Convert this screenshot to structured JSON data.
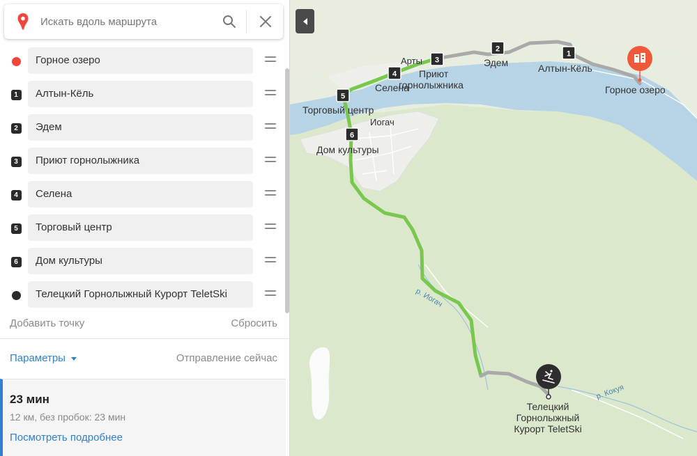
{
  "search": {
    "placeholder": "Искать вдоль маршрута"
  },
  "waypoints": [
    {
      "label": "Горное озеро",
      "marker": "red-dot"
    },
    {
      "label": "Алтын-Кёль",
      "marker": "1"
    },
    {
      "label": "Эдем",
      "marker": "2"
    },
    {
      "label": "Приют горнолыжника",
      "marker": "3"
    },
    {
      "label": "Селена",
      "marker": "4"
    },
    {
      "label": "Торговый центр",
      "marker": "5"
    },
    {
      "label": "Дом культуры",
      "marker": "6"
    },
    {
      "label": "Телецкий Горнолыжный Курорт TeletSki",
      "marker": "black-dot"
    }
  ],
  "actions": {
    "add_point": "Добавить точку",
    "reset": "Сбросить"
  },
  "params": {
    "label": "Параметры",
    "departure": "Отправление сейчас"
  },
  "route": {
    "time": "23 мин",
    "details": "12 км, без пробок: 23 мин",
    "more": "Посмотреть подробнее"
  },
  "map": {
    "labels": {
      "artybash": "Арты",
      "priut_1": "Приют",
      "priut_2": "горнолыжника",
      "edem": "Эдем",
      "altyn": "Алтын-Кёль",
      "gornoe": "Горное озеро",
      "selena": "Селена",
      "trade": "Торговый центр",
      "iogach": "Иогач",
      "dom": "Дом культуры",
      "river_iogach": "р. Иогач",
      "river_kokuya": "р. Кокуя",
      "resort_1": "Телецкий",
      "resort_2": "Горнолыжный",
      "resort_3": "Курорт TeletSki"
    },
    "markers": {
      "m1": "1",
      "m2": "2",
      "m3": "3",
      "m4": "4",
      "m5": "5",
      "m6": "6"
    }
  },
  "colors": {
    "accent": "#2f80d1",
    "route_active": "#7ac74f",
    "route_inactive": "#a9a9a9",
    "start_marker": "#f2453d",
    "hotel_marker": "#f05a3a",
    "water": "#b4d3e6",
    "forest": "#dce9cf",
    "land": "#ecede6"
  },
  "icons": {
    "logo": "map-pin-icon",
    "search": "search-icon",
    "close": "close-icon",
    "drag": "drag-handle-icon",
    "collapse": "collapse-panel-icon",
    "hotel": "hotel-icon",
    "ski": "skier-icon"
  }
}
